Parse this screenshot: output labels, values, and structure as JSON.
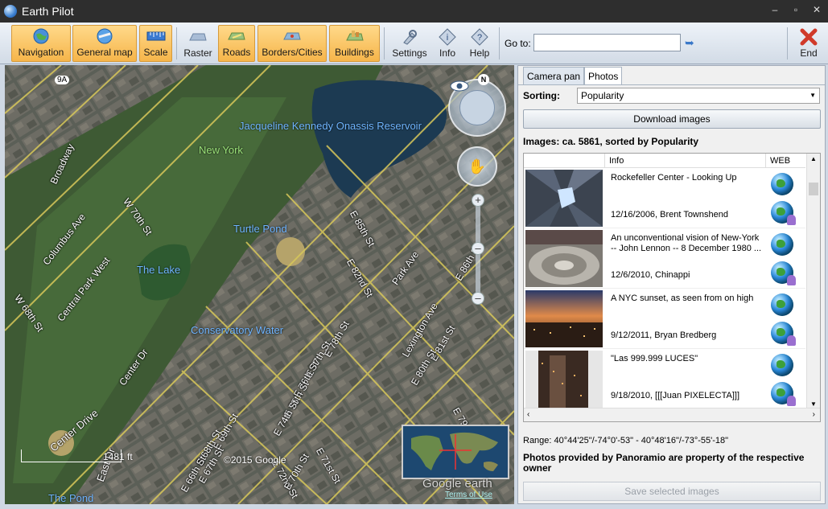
{
  "window": {
    "title": "Earth Pilot"
  },
  "toolbar": {
    "buttons": [
      {
        "label": "Navigation",
        "icon": "globe-icon",
        "active": true
      },
      {
        "label": "General map",
        "icon": "map-globe-icon",
        "active": true
      },
      {
        "label": "Scale",
        "icon": "ruler-icon",
        "active": true
      },
      {
        "label": "Raster",
        "icon": "raster-icon",
        "active": false
      },
      {
        "label": "Roads",
        "icon": "roads-icon",
        "active": true
      },
      {
        "label": "Borders/Cities",
        "icon": "borders-icon",
        "active": true
      },
      {
        "label": "Buildings",
        "icon": "buildings-icon",
        "active": true
      },
      {
        "label": "Settings",
        "icon": "settings-icon",
        "active": false
      },
      {
        "label": "Info",
        "icon": "info-icon",
        "active": false
      },
      {
        "label": "Help",
        "icon": "help-icon",
        "active": false
      }
    ],
    "goto_label": "Go to:",
    "goto_value": "",
    "end_label": "End"
  },
  "map": {
    "labels": {
      "reservoir": "Jacqueline Kennedy Onassis Reservoir",
      "new_york": "New York",
      "turtle_pond": "Turtle Pond",
      "the_lake": "The Lake",
      "conservatory": "Conservatory Water",
      "the_pond": "The Pond",
      "route": "9A"
    },
    "streets": {
      "broadway": "Broadway",
      "columbus": "Columbus Ave",
      "cpw": "Central Park West",
      "w68": "W 68th St",
      "w70": "W 70th St",
      "center_dr": "Center Dr",
      "center_drive": "Center Drive",
      "east_dr": "East Dr",
      "e85": "E 85th St",
      "e82": "E 82nd St",
      "park_ave": "Park Ave",
      "lex_ave": "Lexington Ave",
      "e86": "E 86th St",
      "e81": "E 81st St",
      "e80": "E 80th St",
      "e79": "E 79th St",
      "e78": "E 78th St",
      "e77": "E 77th St",
      "e76": "E 76th St",
      "e75": "E 75th St",
      "e74": "E 74th St",
      "e72": "E 72nd St",
      "e71": "E 71st St",
      "e70": "E 70th St",
      "e69": "E 69th St",
      "e68": "E 68th St",
      "e67": "E 67th St",
      "e66": "E 66th St"
    },
    "scale_text": "1481 ft",
    "copyright": "©2015 Google",
    "compass_letter": "N",
    "minimap_logo": "Google earth",
    "terms": "Terms of Use"
  },
  "panel": {
    "tabs": [
      {
        "label": "Camera pan",
        "selected": false
      },
      {
        "label": "Photos",
        "selected": true
      }
    ],
    "sorting_label": "Sorting:",
    "sorting_value": "Popularity",
    "download_label": "Download images",
    "images_summary": "Images: ca. 5861, sorted by Popularity",
    "columns": {
      "info": "Info",
      "web": "WEB"
    },
    "photos": [
      {
        "title": "Rockefeller Center - Looking Up",
        "meta": "12/16/2006, Brent Townshend"
      },
      {
        "title": "An unconventional vision of New-York -- John Lennon -- 8 December 1980 ...",
        "meta": "12/6/2010, Chinappi"
      },
      {
        "title": "A NYC sunset, as seen from on high",
        "meta": "9/12/2011, Bryan Bredberg"
      },
      {
        "title": "\"Las 999.999 LUCES\"",
        "meta": "9/18/2010, [[[Juan PIXELECTA]]]"
      }
    ],
    "range": "Range: 40°44'25\"/-74°0'-53\" - 40°48'16\"/-73°-55'-18\"",
    "provided_note": "Photos provided by Panoramio are property of the respective owner",
    "save_label": "Save selected images"
  }
}
